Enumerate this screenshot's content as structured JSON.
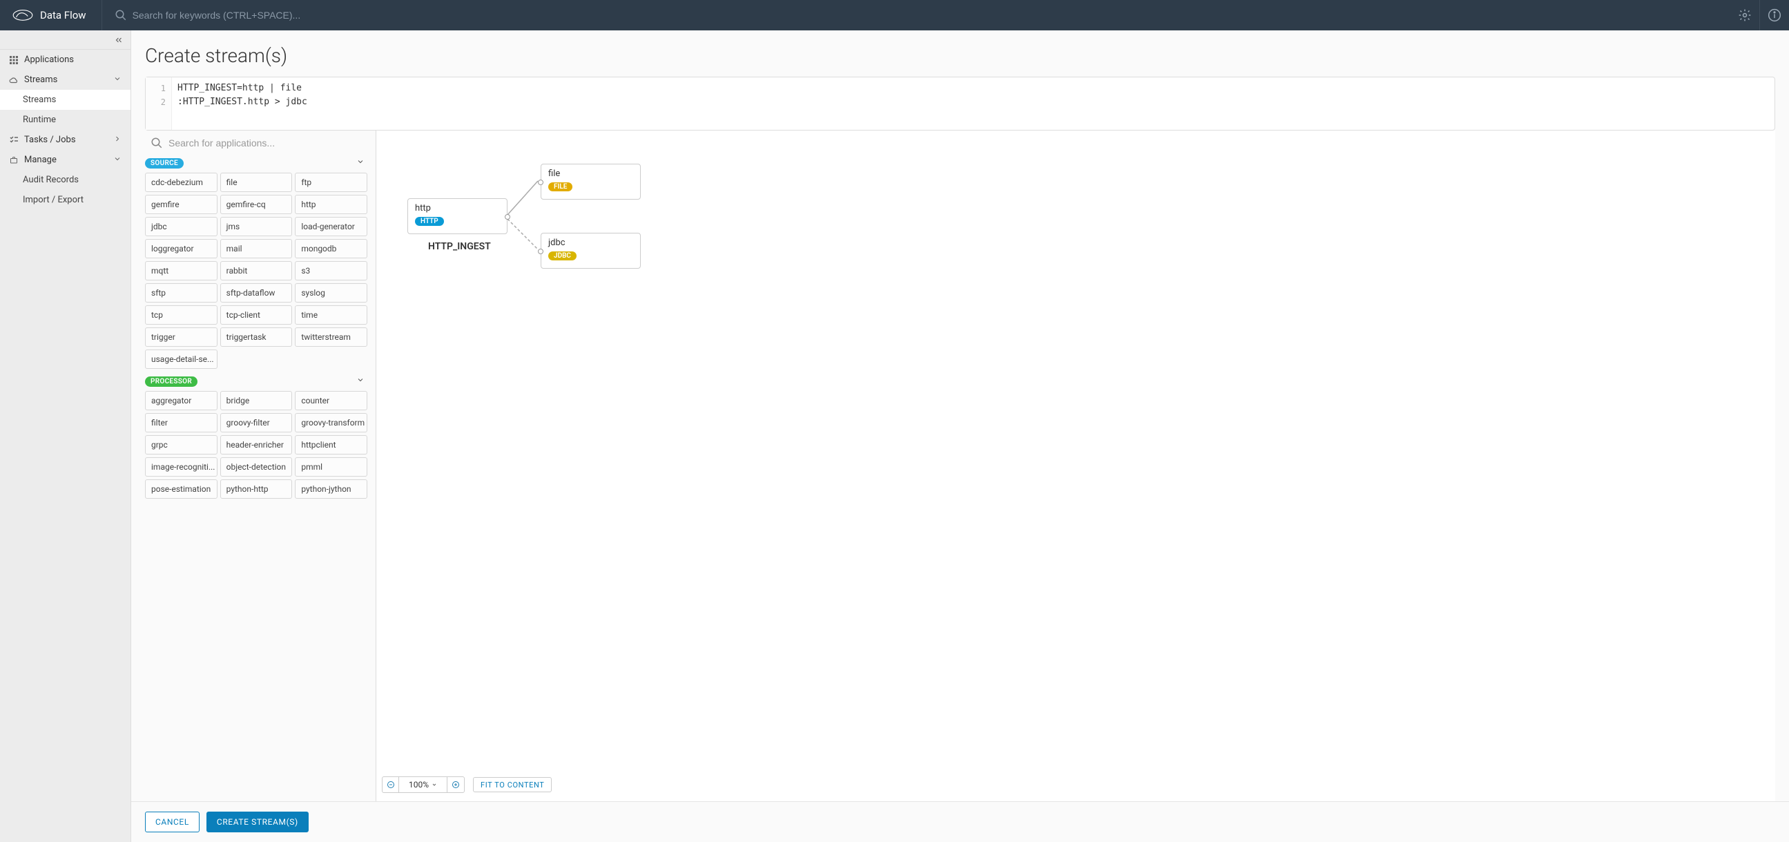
{
  "brand": {
    "title": "Data Flow"
  },
  "search": {
    "placeholder": "Search for keywords (CTRL+SPACE)..."
  },
  "sidebar": {
    "items": [
      {
        "label": "Applications"
      },
      {
        "label": "Streams"
      },
      {
        "label": "Tasks / Jobs"
      },
      {
        "label": "Manage"
      }
    ],
    "streams_children": [
      {
        "label": "Streams"
      },
      {
        "label": "Runtime"
      }
    ],
    "manage_children": [
      {
        "label": "Audit Records"
      },
      {
        "label": "Import / Export"
      }
    ]
  },
  "page": {
    "title": "Create stream(s)"
  },
  "dsl": {
    "line1_num": "1",
    "line2_num": "2",
    "line1": "HTTP_INGEST=http | file",
    "line2": ":HTTP_INGEST.http > jdbc"
  },
  "palette": {
    "search_placeholder": "Search for applications...",
    "source_label": "SOURCE",
    "processor_label": "PROCESSOR",
    "source": [
      "cdc-debezium",
      "file",
      "ftp",
      "gemfire",
      "gemfire-cq",
      "http",
      "jdbc",
      "jms",
      "load-generator",
      "loggregator",
      "mail",
      "mongodb",
      "mqtt",
      "rabbit",
      "s3",
      "sftp",
      "sftp-dataflow",
      "syslog",
      "tcp",
      "tcp-client",
      "time",
      "trigger",
      "triggertask",
      "twitterstream",
      "usage-detail-se..."
    ],
    "processor": [
      "aggregator",
      "bridge",
      "counter",
      "filter",
      "groovy-filter",
      "groovy-transform",
      "grpc",
      "header-enricher",
      "httpclient",
      "image-recogniti...",
      "object-detection",
      "pmml",
      "pose-estimation",
      "python-http",
      "python-jython"
    ]
  },
  "canvas": {
    "stream_label": "HTTP_INGEST",
    "nodes": {
      "http": {
        "title": "http",
        "badge": "HTTP"
      },
      "file": {
        "title": "file",
        "badge": "FILE"
      },
      "jdbc": {
        "title": "jdbc",
        "badge": "JDBC"
      }
    }
  },
  "zoom": {
    "level": "100%",
    "fit": "FIT TO CONTENT"
  },
  "actions": {
    "cancel": "CANCEL",
    "create": "CREATE STREAM(S)"
  }
}
